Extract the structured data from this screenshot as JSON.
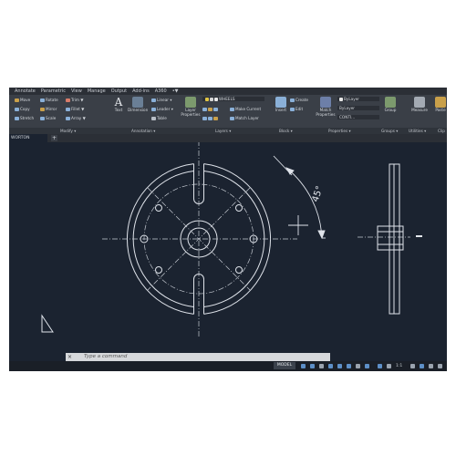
{
  "menubar": {
    "items": [
      "Annotate",
      "Parametric",
      "View",
      "Manage",
      "Output",
      "Add-ins",
      "A360",
      "•▼"
    ]
  },
  "ribbon": {
    "modify": {
      "row1": [
        "Move",
        "Rotate",
        "Trim",
        "▼"
      ],
      "row2": [
        "Copy",
        "Mirror",
        "Fillet",
        "▼"
      ],
      "row3": [
        "Stretch",
        "Scale",
        "Array",
        "▼"
      ]
    },
    "annotation": {
      "text_button": "Text",
      "dimension_button": "Dimension",
      "linear": "Linear",
      "leader": "Leader",
      "table": "Table"
    },
    "layers": {
      "layer_properties_button": "Layer Properties",
      "layer_name": "WHEELS",
      "make_current": "Make Current",
      "match_layer": "Match Layer"
    },
    "block": {
      "insert_button": "Insert",
      "create": "Create",
      "edit": "Edit"
    },
    "properties": {
      "match_properties_button": "Match Properties",
      "bylayer_1": "ByLayer",
      "bylayer_2": "ByLayer",
      "contin": "CONTI..."
    },
    "groups": {
      "group_button": "Group"
    },
    "utilities": {
      "measure_button": "Measure"
    },
    "clipboard": {
      "paste_button": "Paste"
    }
  },
  "panel_labels": [
    "Modify ▾",
    "Annotation ▾",
    "Layers ▾",
    "Block ▾",
    "Properties ▾",
    "Groups ▾",
    "Utilities ▾",
    "Clip"
  ],
  "file_tab": {
    "name": "WORTON",
    "plus": "+"
  },
  "drawing": {
    "angle_label": "45°"
  },
  "command_line": {
    "close": "×",
    "prompt": "Type a command"
  },
  "status_bar": {
    "model": "MODEL",
    "scale": "1:1"
  },
  "colors": {
    "canvas": "#1b2330",
    "ribbon": "#3a3f47",
    "line": "#dfe3ea",
    "accent": "#5d8fc7"
  }
}
